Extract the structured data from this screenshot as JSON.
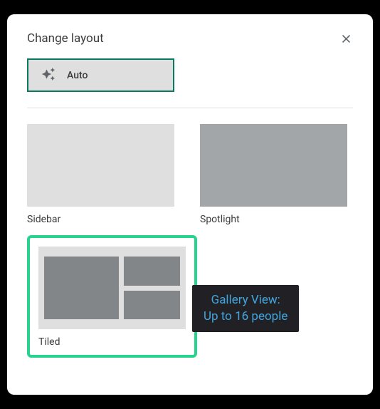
{
  "title": "Change layout",
  "auto": {
    "label": "Auto"
  },
  "options": {
    "sidebar": {
      "label": "Sidebar"
    },
    "spotlight": {
      "label": "Spotlight"
    },
    "tiled": {
      "label": "Tiled"
    }
  },
  "tooltip": {
    "line1": "Gallery View:",
    "line2": "Up to 16 people"
  }
}
